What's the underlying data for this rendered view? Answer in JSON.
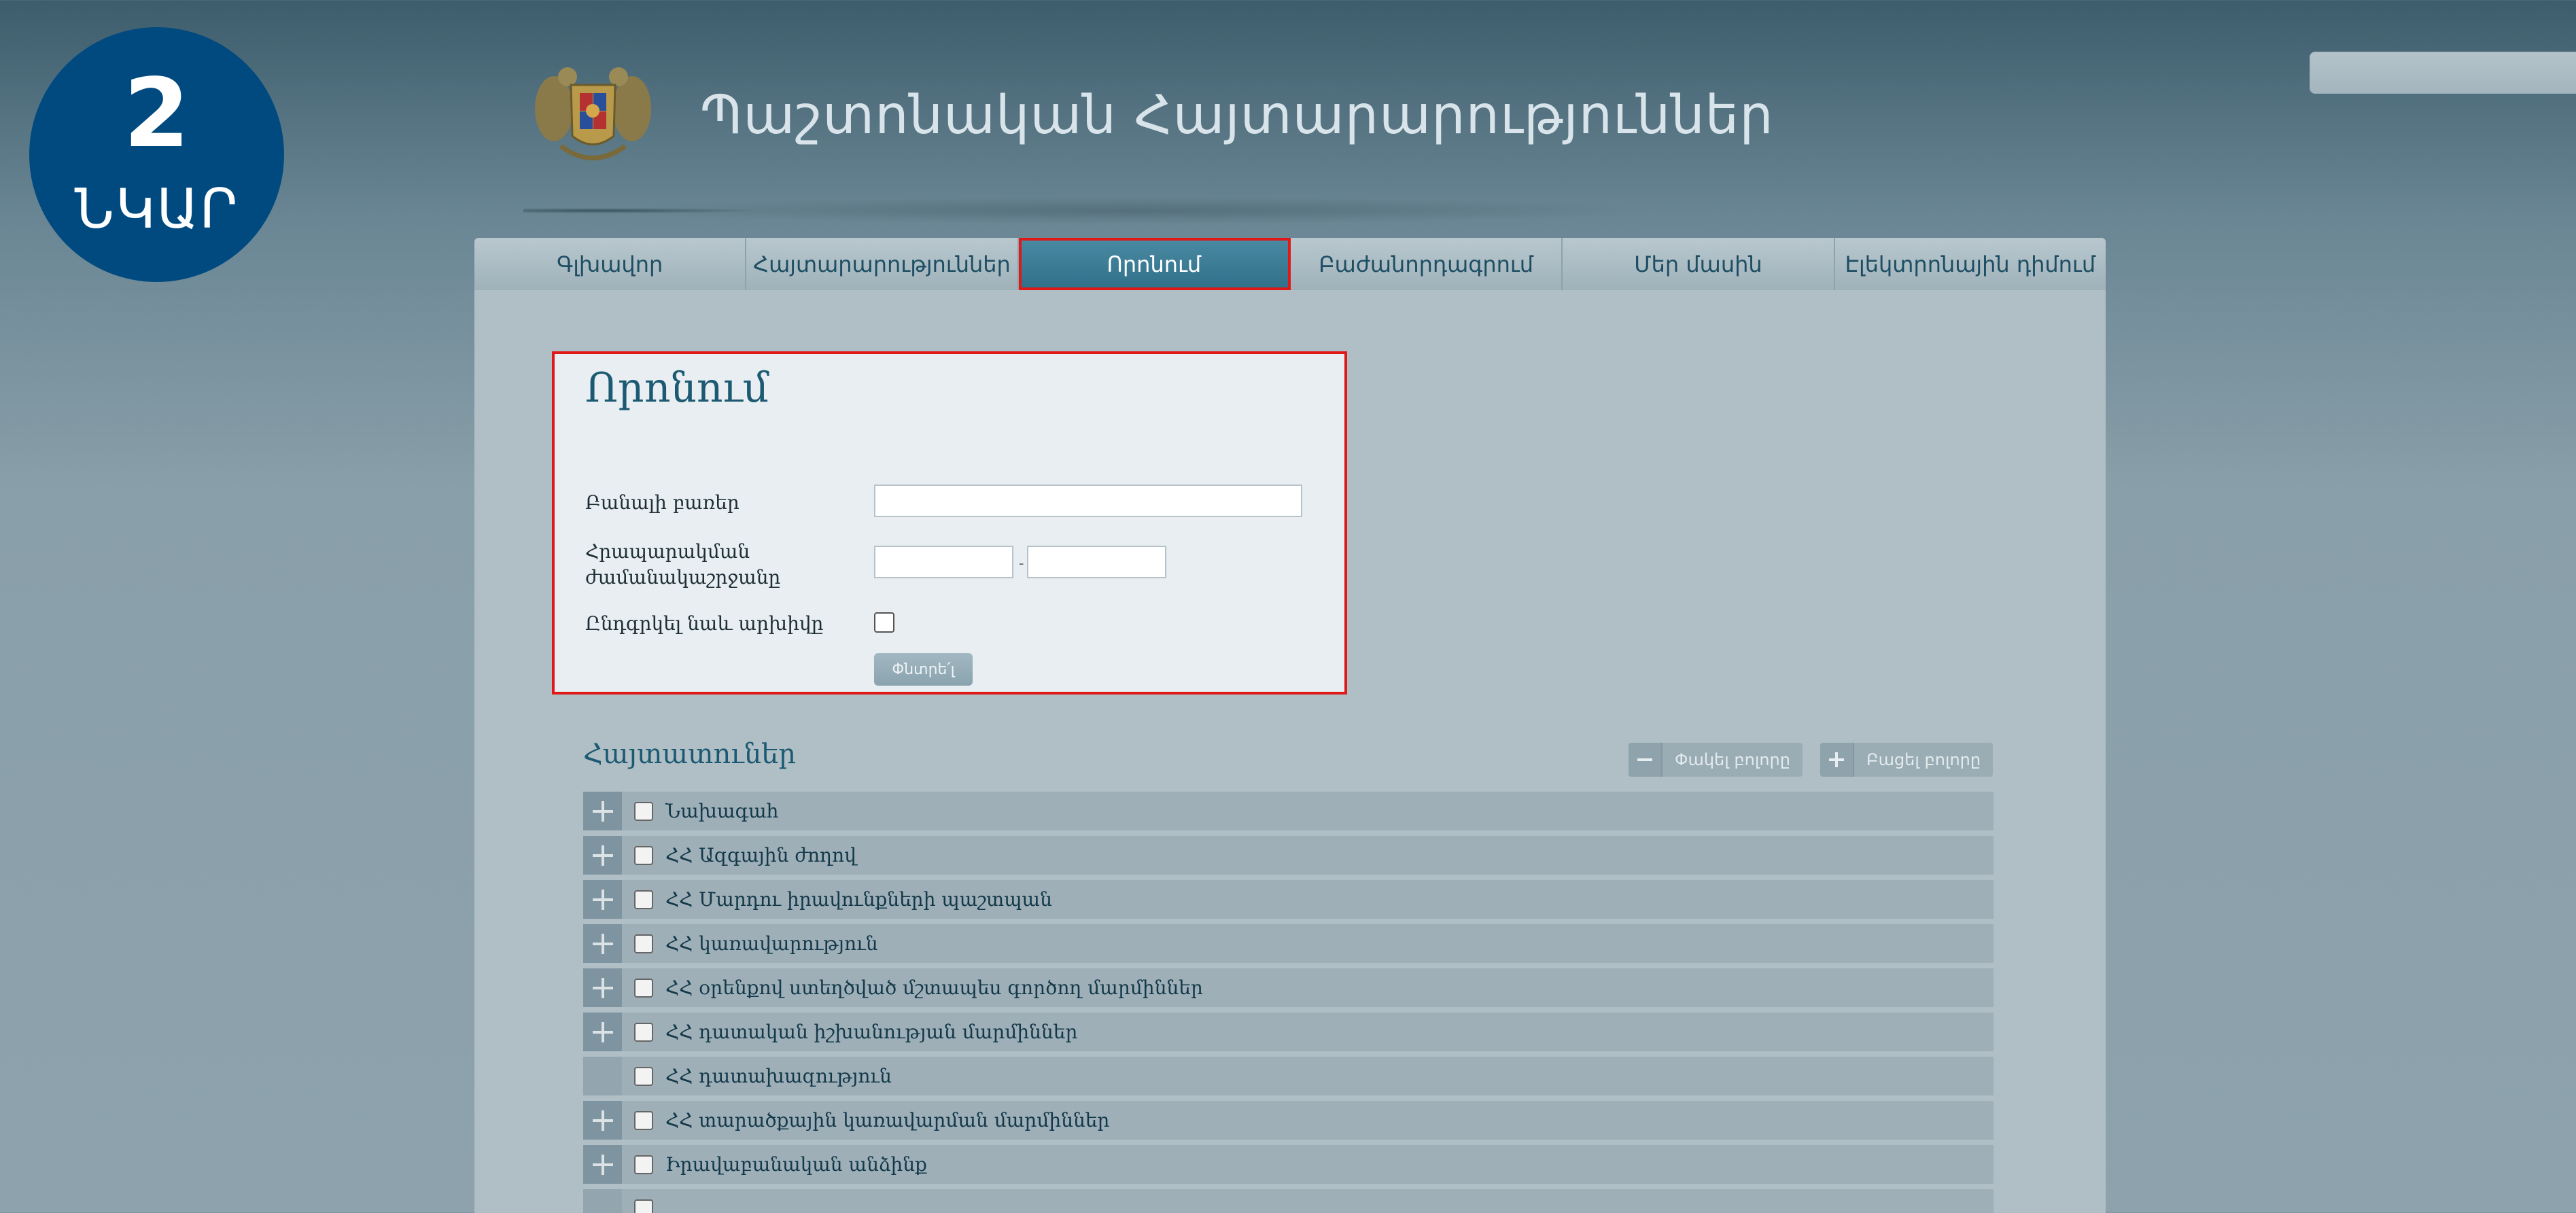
{
  "badge": {
    "number": "2",
    "word": "ՆԿԱՐ"
  },
  "header": {
    "site_title": "Պաշտոնական Հայտարարություններ"
  },
  "search": {
    "placeholder": ""
  },
  "nav": {
    "items": [
      {
        "label": "Գլխավոր"
      },
      {
        "label": "Հայտարարություններ"
      },
      {
        "label": "Որոնում"
      },
      {
        "label": "Բաժանորդագրում"
      },
      {
        "label": "Մեր մասին"
      },
      {
        "label": "Էլեկտրոնային դիմում"
      }
    ]
  },
  "search_form": {
    "title": "Որոնում",
    "keywords_label": "Բանալի բառեր",
    "period_label_line1": "Հրապարակման",
    "period_label_line2": "ժամանակաշրջանը",
    "date_separator": "-",
    "archive_label": "Ընդգրկել նաև արխիվը",
    "submit_label": "Փնտրե՛լ"
  },
  "organizations": {
    "title": "Հայտատուներ",
    "collapse_all_label": "Փակել բոլորը",
    "expand_all_label": "Բացել բոլորը",
    "items": [
      {
        "label": "Նախագահ",
        "expandable": true
      },
      {
        "label": "ՀՀ Ազգային ժողով",
        "expandable": true
      },
      {
        "label": "ՀՀ Մարդու իրավունքների պաշտպան",
        "expandable": true
      },
      {
        "label": "ՀՀ կառավարություն",
        "expandable": true
      },
      {
        "label": "ՀՀ օրենքով ստեղծված մշտապես գործող մարմիններ",
        "expandable": true
      },
      {
        "label": "ՀՀ դատական իշխանության մարմիններ",
        "expandable": true
      },
      {
        "label": "ՀՀ դատախազություն",
        "expandable": false
      },
      {
        "label": "ՀՀ տարածքային կառավարման մարմիններ",
        "expandable": true
      },
      {
        "label": "Իրավաբանական անձինք",
        "expandable": true
      }
    ]
  }
}
